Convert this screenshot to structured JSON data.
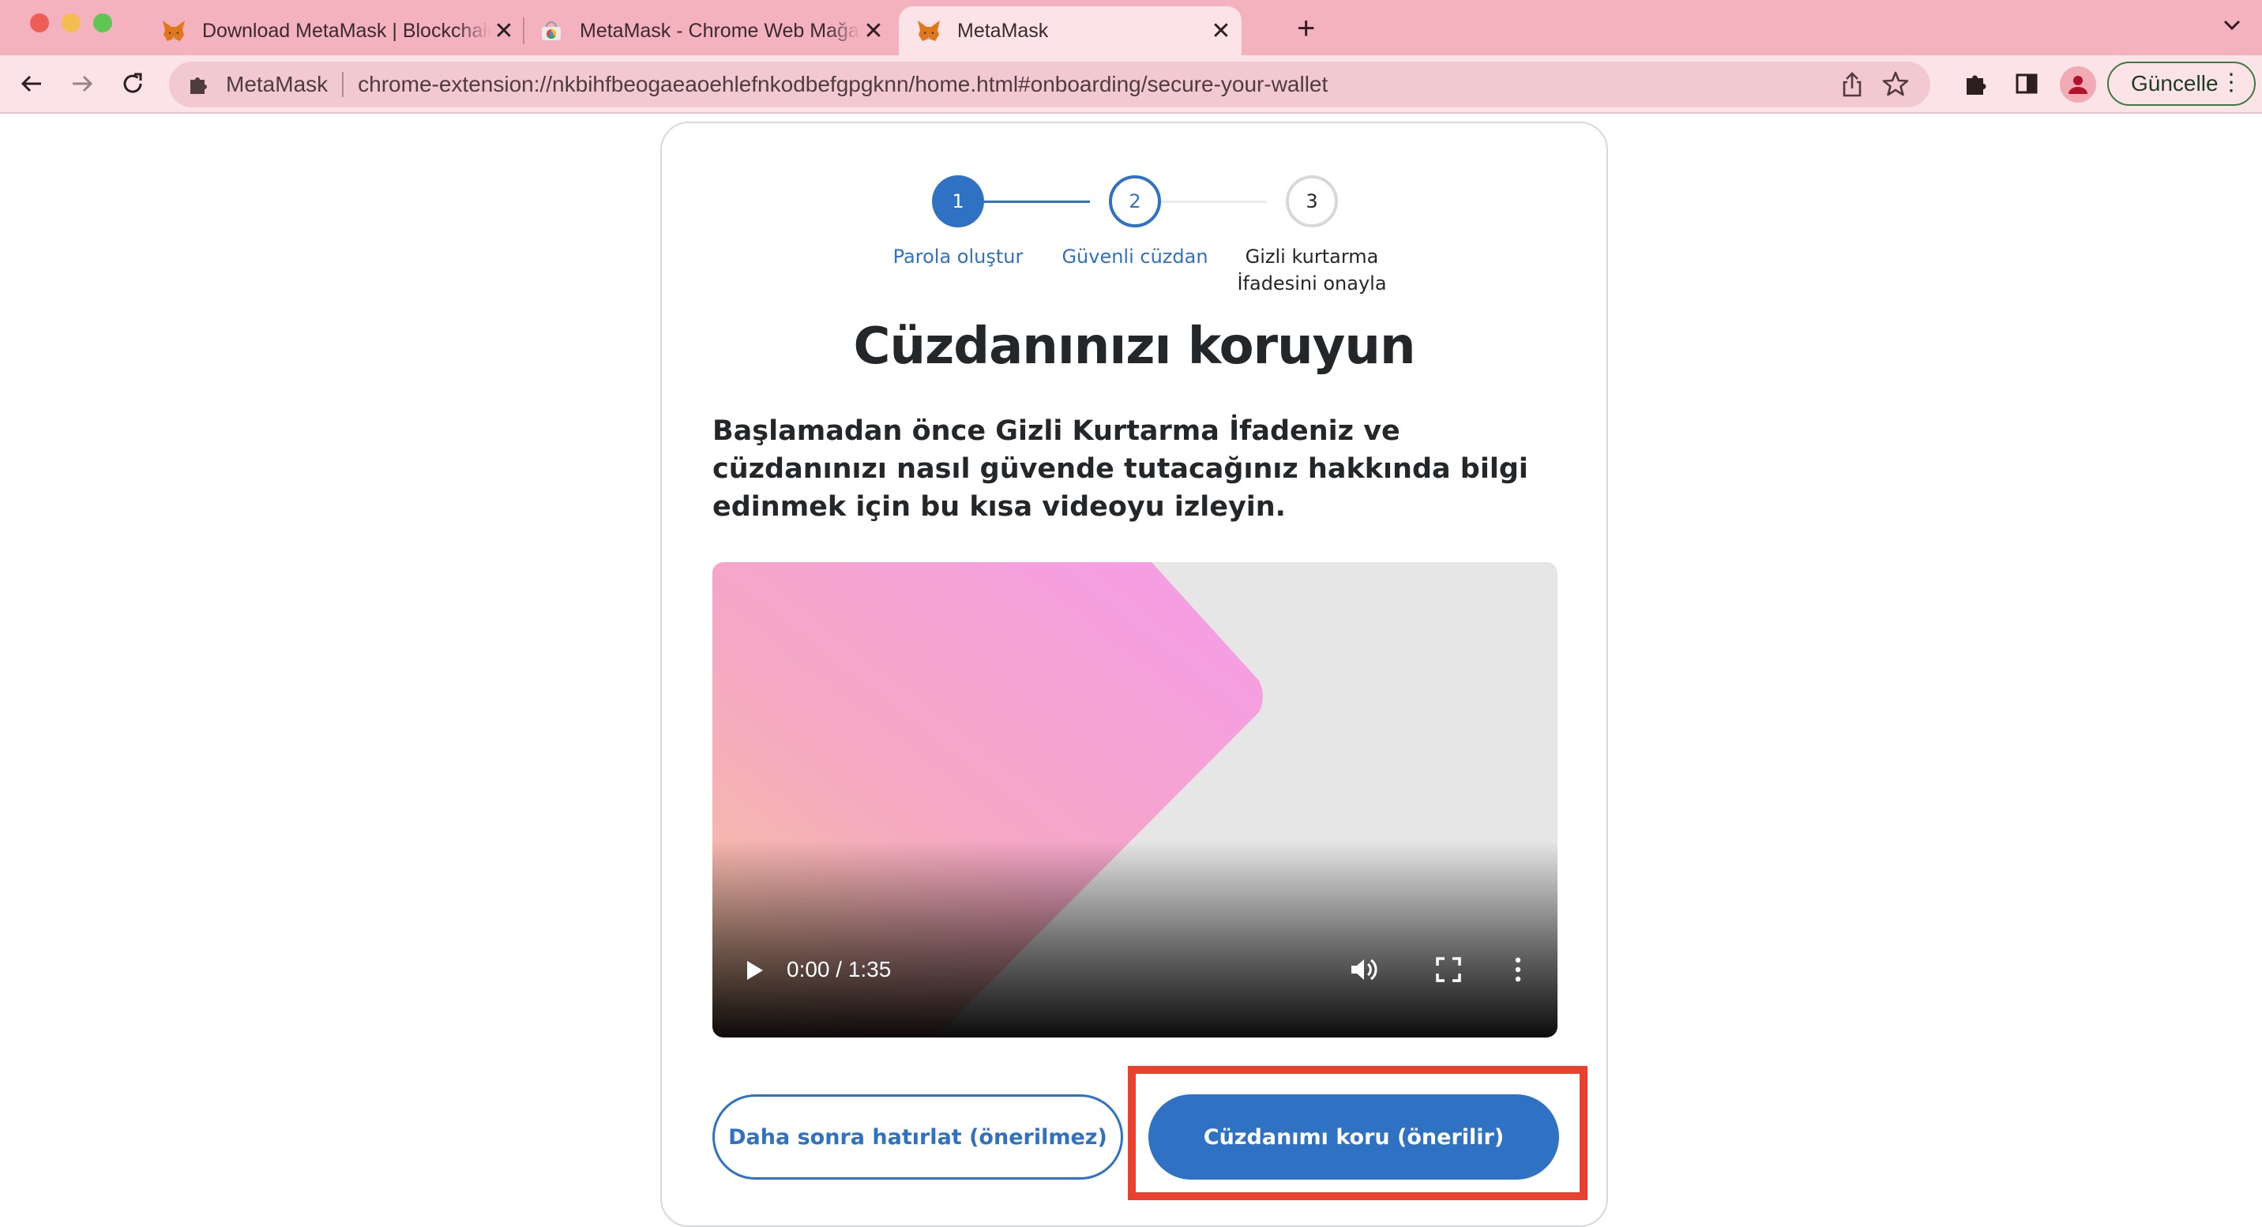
{
  "browser": {
    "tabs": [
      {
        "title": "Download MetaMask | Blockchain Wallet",
        "favicon": "metamask-fox-icon"
      },
      {
        "title": "MetaMask - Chrome Web Mağazası",
        "favicon": "chrome-web-store-icon"
      },
      {
        "title": "MetaMask",
        "favicon": "metamask-fox-icon"
      }
    ],
    "omnibox": {
      "site_name": "MetaMask",
      "url": "chrome-extension://nkbihfbeogaeaoehlefnkodbefgpgknn/home.html#onboarding/secure-your-wallet"
    },
    "update_label": "Güncelle"
  },
  "stepper": {
    "steps": [
      {
        "number": "1",
        "label": "Parola oluştur"
      },
      {
        "number": "2",
        "label": "Güvenli cüzdan"
      },
      {
        "number": "3",
        "label": "Gizli kurtarma\nİfadesini onayla"
      }
    ]
  },
  "page": {
    "heading": "Cüzdanınızı koruyun",
    "description": "Başlamadan önce Gizli Kurtarma İfadeniz ve cüzdanınızı nasıl güvende tutacağınız hakkında bilgi edinmek için bu kısa videoyu izleyin.",
    "video": {
      "time": "0:00 / 1:35",
      "progress": 0
    },
    "buttons": {
      "later": "Daha sonra hatırlat (önerilmez)",
      "secure": "Cüzdanımı koru (önerilir)"
    }
  },
  "colors": {
    "tabstrip": "#f3b2bd",
    "toolbar": "#fbe3e8",
    "primary": "#2f72c4",
    "highlight": "#e8412f"
  }
}
